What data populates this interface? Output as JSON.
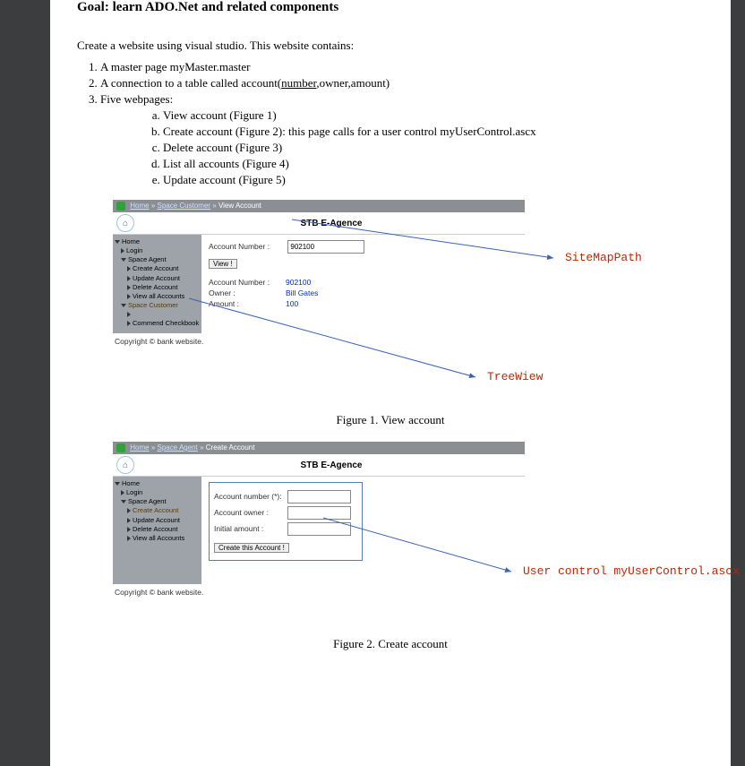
{
  "goal_line": "Goal: learn ADO.Net and related components",
  "intro": "Create a website using visual studio. This website contains:",
  "list": {
    "i1": "A master page myMaster.master",
    "i2_pre": "A connection to a table called account(",
    "i2_u": "number",
    "i2_post": ",owner,amount)",
    "i3": "Five webpages:",
    "sub": {
      "a": "View account (Figure 1)",
      "b": "Create account (Figure 2): this page calls for a user control myUserControl.ascx",
      "c": "Delete account (Figure 3)",
      "d": "List all accounts (Figure 4)",
      "e": "Update account (Figure 5)"
    }
  },
  "figure1": {
    "caption": "Figure 1. View account",
    "breadcrumb": {
      "b1": "Home",
      "b2": "Space Customer",
      "b3": "View Account"
    },
    "site_title": "STB E-Agence",
    "tree": {
      "home": "Home",
      "login": "Login",
      "agent": "Space Agent",
      "create": "Create Account",
      "update": "Update Account",
      "delete": "Delete Account",
      "viewall": "View all Accounts",
      "customer": "Space Customer",
      "command": "Commend Checkbook"
    },
    "form": {
      "label": "Account Number :",
      "value": "902100",
      "button": "View !"
    },
    "result": {
      "r1l": "Account Number :",
      "r1v": "902100",
      "r2l": "Owner :",
      "r2v": "Bill Gates",
      "r3l": "Amount :",
      "r3v": "100"
    },
    "copyright": "Copyright © bank website.",
    "annot1": "SiteMapPath",
    "annot2": "TreeWiew"
  },
  "figure2": {
    "caption": "Figure 2. Create account",
    "breadcrumb": {
      "b1": "Home",
      "b2": "Space Agent",
      "b3": "Create Account"
    },
    "site_title": "STB E-Agence",
    "tree": {
      "home": "Home",
      "login": "Login",
      "agent": "Space Agent",
      "create": "Create Account",
      "update": "Update Account",
      "delete": "Delete Account",
      "viewall": "View all Accounts"
    },
    "form": {
      "l1": "Account number (*):",
      "l2": "Account owner :",
      "l3": "Initial amount :",
      "button": "Create this Account !"
    },
    "copyright": "Copyright © bank website.",
    "annot": "User control myUserControl.ascx"
  }
}
